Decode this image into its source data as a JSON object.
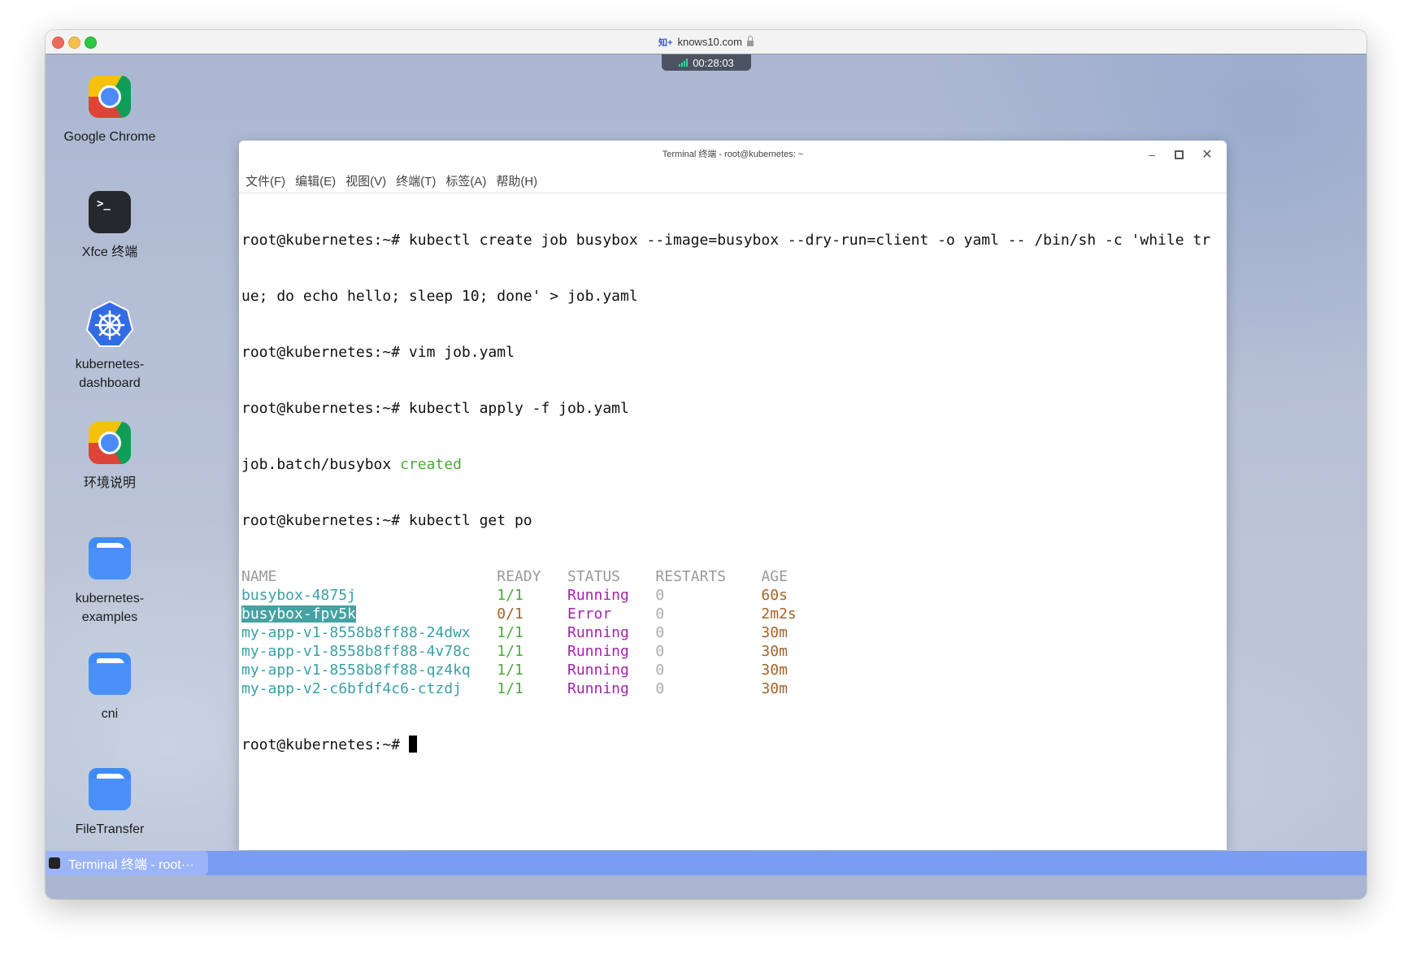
{
  "browser": {
    "url": "knows10.com",
    "site_logo": "知+",
    "timer": "00:28:03"
  },
  "desktop_icons": [
    {
      "label": "Google Chrome",
      "icon": "chrome-icon"
    },
    {
      "label": "Xfce 终端",
      "icon": "terminal-icon"
    },
    {
      "label": "kubernetes-\ndashboard",
      "icon": "kubernetes-icon"
    },
    {
      "label": "环境说明",
      "icon": "chrome-icon"
    },
    {
      "label": "kubernetes-\nexamples",
      "icon": "folder-icon"
    },
    {
      "label": "cni",
      "icon": "folder-icon"
    },
    {
      "label": "FileTransfer",
      "icon": "folder-icon"
    }
  ],
  "terminal": {
    "title": "Terminal 终端 - root@kubernetes: ~",
    "menu": [
      "文件(F)",
      "编辑(E)",
      "视图(V)",
      "终端(T)",
      "标签(A)",
      "帮助(H)"
    ],
    "prompt": "root@kubernetes:~# ",
    "lines": [
      "root@kubernetes:~# kubectl create job busybox --image=busybox --dry-run=client -o yaml -- /bin/sh -c 'while tr",
      "ue; do echo hello; sleep 10; done' > job.yaml",
      "root@kubernetes:~# vim job.yaml",
      "root@kubernetes:~# kubectl apply -f job.yaml"
    ],
    "apply_result": {
      "resource": "job.batch/busybox ",
      "status": "created"
    },
    "get_cmd": "root@kubernetes:~# kubectl get po",
    "table_headers": [
      "NAME",
      "READY",
      "STATUS",
      "RESTARTS",
      "AGE"
    ],
    "pods": [
      {
        "name": "busybox-4875j",
        "ready": "1/1",
        "status": "Running",
        "restarts": "0",
        "age": "60s",
        "ready_ok": true,
        "selected": false
      },
      {
        "name": "busybox-fpv5k",
        "ready": "0/1",
        "status": "Error",
        "restarts": "0",
        "age": "2m2s",
        "ready_ok": false,
        "selected": true
      },
      {
        "name": "my-app-v1-8558b8ff88-24dwx",
        "ready": "1/1",
        "status": "Running",
        "restarts": "0",
        "age": "30m",
        "ready_ok": true,
        "selected": false
      },
      {
        "name": "my-app-v1-8558b8ff88-4v78c",
        "ready": "1/1",
        "status": "Running",
        "restarts": "0",
        "age": "30m",
        "ready_ok": true,
        "selected": false
      },
      {
        "name": "my-app-v1-8558b8ff88-qz4kq",
        "ready": "1/1",
        "status": "Running",
        "restarts": "0",
        "age": "30m",
        "ready_ok": true,
        "selected": false
      },
      {
        "name": "my-app-v2-c6bfdf4c6-ctzdj",
        "ready": "1/1",
        "status": "Running",
        "restarts": "0",
        "age": "30m",
        "ready_ok": true,
        "selected": false
      }
    ]
  },
  "taskbar": {
    "items": [
      {
        "label": "Terminal 终端 - root···"
      }
    ]
  },
  "colors": {
    "taskbar": "#7a9cf5",
    "ready_ok": "#4ca83a",
    "name": "#3aa0a8",
    "status": "#a523ad",
    "age": "#a5622a",
    "selection": "#46a2a2"
  }
}
